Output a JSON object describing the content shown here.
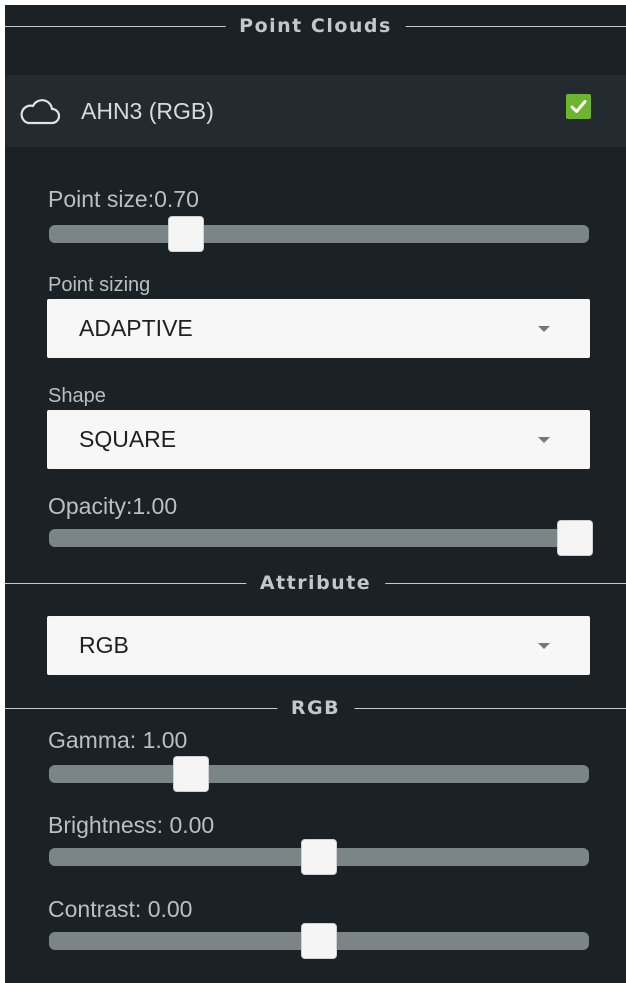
{
  "sections": {
    "point_clouds": "Point Clouds",
    "attribute": "Attribute",
    "rgb": "RGB"
  },
  "point_cloud": {
    "name": "AHN3 (RGB)",
    "icon": "cloud-icon",
    "visible": true
  },
  "controls": {
    "point_size": {
      "label": "Point size:0.70",
      "fraction": 0.24
    },
    "point_sizing": {
      "label": "Point sizing",
      "value": "ADAPTIVE"
    },
    "shape": {
      "label": "Shape",
      "value": "SQUARE"
    },
    "opacity": {
      "label": "Opacity:1.00",
      "fraction": 1.0
    },
    "attribute": {
      "value": "RGB"
    },
    "gamma": {
      "label": "Gamma: 1.00",
      "fraction": 0.25
    },
    "brightness": {
      "label": "Brightness: 0.00",
      "fraction": 0.5
    },
    "contrast": {
      "label": "Contrast: 0.00",
      "fraction": 0.5
    }
  },
  "colors": {
    "panel_bg": "#1b2124",
    "header_bg": "#232b30",
    "checkbox_green": "#6cb52d",
    "slider_track": "#7b8588"
  }
}
